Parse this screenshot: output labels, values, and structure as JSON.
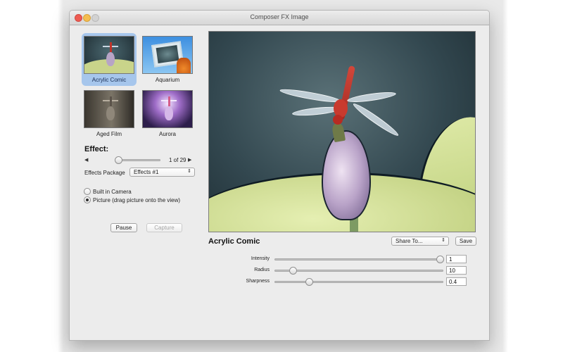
{
  "window": {
    "title": "Composer FX Image"
  },
  "thumbnails": [
    {
      "label": "Acrylic Comic",
      "selected": true
    },
    {
      "label": "Aquarium",
      "selected": false
    },
    {
      "label": "Aged Film",
      "selected": false
    },
    {
      "label": "Aurora",
      "selected": false
    }
  ],
  "effect": {
    "heading": "Effect:",
    "counter": "1 of 29",
    "prev_arrow": "◀",
    "next_arrow": "▶",
    "slider_fraction": 0.0
  },
  "package": {
    "label": "Effects Package",
    "value": "Effects #1"
  },
  "source": {
    "options": [
      {
        "label": "Built in Camera",
        "selected": false
      },
      {
        "label": "Picture (drag picture onto the view)",
        "selected": true
      }
    ]
  },
  "buttons": {
    "pause": "Pause",
    "capture": "Capture",
    "save": "Save"
  },
  "share": {
    "value": "Share To..."
  },
  "preview": {
    "effect_name": "Acrylic Comic"
  },
  "params": [
    {
      "label": "Intensity",
      "value": "1",
      "fraction": 1.0
    },
    {
      "label": "Radius",
      "value": "10",
      "fraction": 0.1
    },
    {
      "label": "Sharpness",
      "value": "0.4",
      "fraction": 0.2
    }
  ],
  "colors": {
    "selection": "#a6c6ec",
    "window_bg": "#ececec"
  }
}
